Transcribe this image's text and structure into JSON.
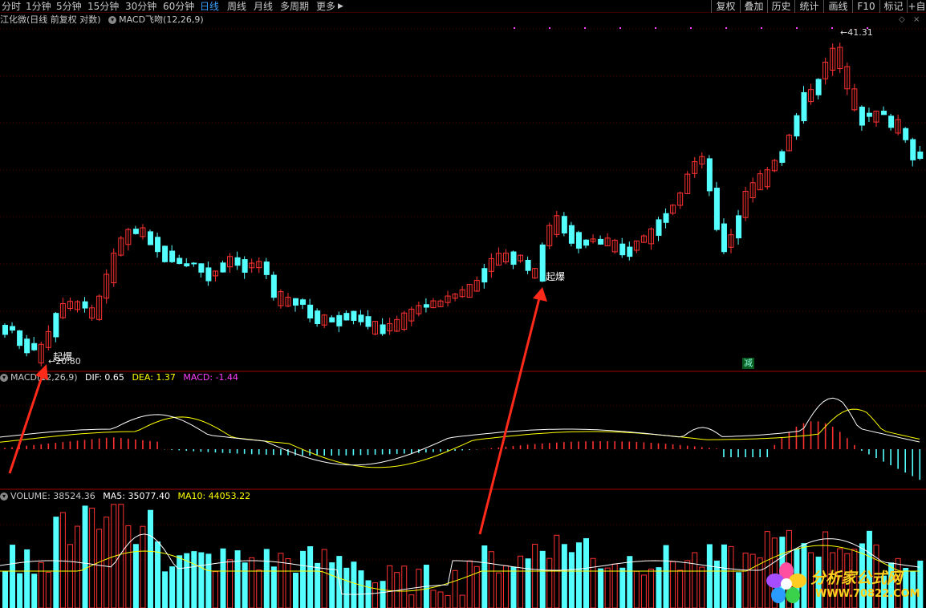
{
  "toolbar": {
    "periods": [
      "分时",
      "1分钟",
      "5分钟",
      "15分钟",
      "30分钟",
      "60分钟",
      "日线",
      "周线",
      "月线",
      "多周期",
      "更多"
    ],
    "active_period": "日线",
    "more_arrow": "▶",
    "right_buttons": [
      "复权",
      "叠加",
      "历史",
      "统计",
      "画线",
      "F10",
      "标记",
      "+自"
    ]
  },
  "main_panel": {
    "title": "江化微(日线 前复权 对数)",
    "indicator_label": "MACD飞吻(12,26,9)",
    "high_label": "41.31",
    "low_label": "20.80",
    "signal_label": "起爆",
    "jian_label": "减"
  },
  "macd_panel": {
    "name": "MACD(12,26,9)",
    "dif": "DIF: 0.65",
    "dea": "DEA: 1.37",
    "macd": "MACD: -1.44",
    "dif_color": "#ffffff",
    "dea_color": "#ffff00",
    "macd_color": "#ff40ff"
  },
  "volume_panel": {
    "volume": "VOLUME: 38524.36",
    "ma5": "MA5: 35077.40",
    "ma10": "MA10: 44053.22"
  },
  "watermark": {
    "title": "分析家公式网",
    "url": "WWW.70822.COM"
  },
  "colors": {
    "up": "#ff3232",
    "down": "#54ffff",
    "grid": "#5a0000",
    "arrow": "#ff2a1a"
  }
}
